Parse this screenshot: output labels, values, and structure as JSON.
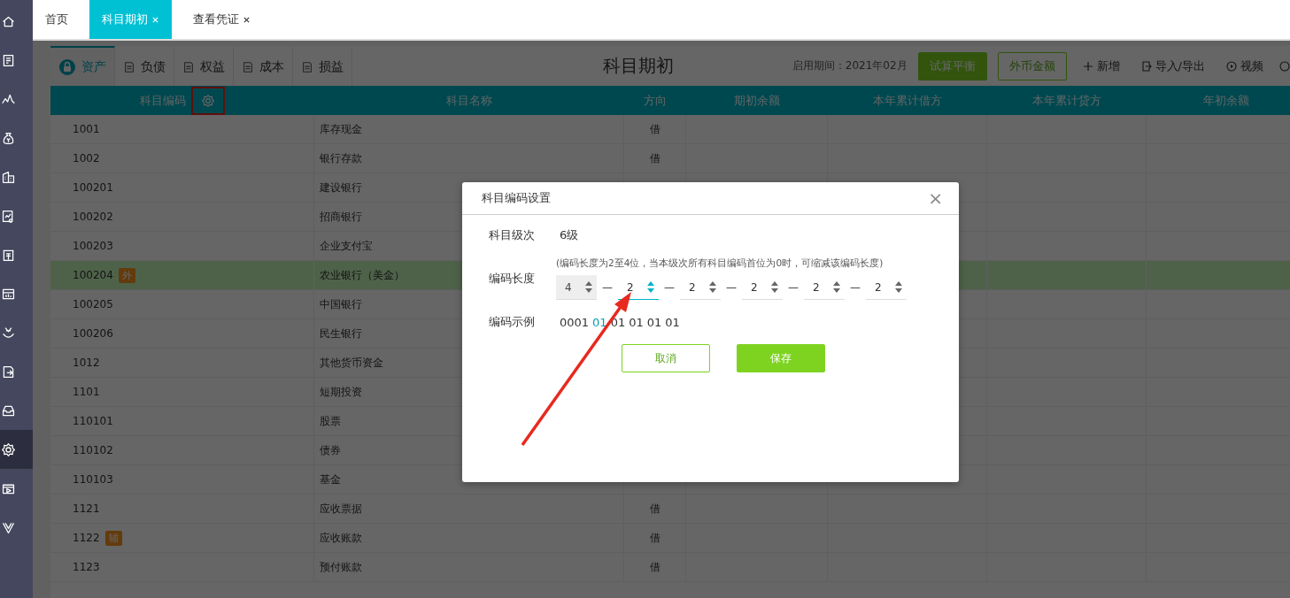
{
  "sidebar": {
    "items": [
      {
        "selected": false
      },
      {
        "selected": false
      },
      {
        "selected": false
      },
      {
        "selected": false
      },
      {
        "selected": false
      },
      {
        "selected": false
      },
      {
        "selected": false
      },
      {
        "selected": false
      },
      {
        "selected": false
      },
      {
        "selected": false
      },
      {
        "selected": false
      },
      {
        "selected": true
      },
      {
        "selected": false
      },
      {
        "selected": false
      }
    ]
  },
  "tabs": [
    {
      "label": "首页",
      "selected": false,
      "closable": false
    },
    {
      "label": "科目期初",
      "selected": true,
      "closable": true
    },
    {
      "label": "查看凭证",
      "selected": false,
      "closable": true
    }
  ],
  "categories": [
    {
      "label": "资产",
      "selected": true
    },
    {
      "label": "负债",
      "selected": false
    },
    {
      "label": "权益",
      "selected": false
    },
    {
      "label": "成本",
      "selected": false
    },
    {
      "label": "损益",
      "selected": false
    }
  ],
  "page_title": "科目期初",
  "period": "启用期间：2021年02月",
  "buttons": [
    {
      "label": "试算平衡",
      "kind": "primary"
    },
    {
      "label": "外币金额",
      "kind": "outline"
    },
    {
      "label": "新增",
      "kind": "add"
    },
    {
      "label": "导入/导出",
      "kind": "import"
    },
    {
      "label": "视频",
      "kind": "video"
    }
  ],
  "table": {
    "columns": [
      "科目编码",
      "科目名称",
      "方向",
      "期初余额",
      "本年累计借方",
      "本年累计贷方",
      "年初余额"
    ],
    "rows": [
      {
        "code": "1001",
        "name": "库存现金",
        "direction": "借",
        "selected": false
      },
      {
        "code": "1002",
        "name": "银行存款",
        "direction": "借",
        "selected": false
      },
      {
        "code": "100201",
        "name": "建设银行",
        "selected": false
      },
      {
        "code": "100202",
        "name": "招商银行",
        "selected": false
      },
      {
        "code": "100203",
        "name": "企业支付宝",
        "selected": false
      },
      {
        "code": "100204",
        "badge": "外",
        "name": "农业银行（美金）",
        "selected": true
      },
      {
        "code": "100205",
        "name": "中国银行",
        "selected": false
      },
      {
        "code": "100206",
        "name": "民生银行",
        "selected": false
      },
      {
        "code": "1012",
        "name": "其他货币资金",
        "selected": false
      },
      {
        "code": "1101",
        "name": "短期投资",
        "selected": false
      },
      {
        "code": "110101",
        "name": "股票",
        "selected": false
      },
      {
        "code": "110102",
        "name": "债券",
        "selected": false
      },
      {
        "code": "110103",
        "name": "基金",
        "selected": false
      },
      {
        "code": "1121",
        "name": "应收票据",
        "direction": "借",
        "selected": false
      },
      {
        "code": "1122",
        "badge": "辅",
        "name": "应收账款",
        "direction": "借",
        "selected": false
      },
      {
        "code": "1123",
        "name": "预付账款",
        "direction": "借",
        "selected": false
      }
    ]
  },
  "dialog": {
    "title": "科目编码设置",
    "close": "×",
    "level_label": "科目级次",
    "level_value": "6级",
    "length_label": "编码长度",
    "length_hint": "(编码长度为2至4位，当本级次所有科目编码首位为0时，可缩减该编码长度)",
    "separator": "—",
    "segments": [
      {
        "value": "4",
        "disabled": true,
        "focused": false
      },
      {
        "value": "2",
        "disabled": false,
        "focused": true
      },
      {
        "value": "2",
        "disabled": false,
        "focused": false
      },
      {
        "value": "2",
        "disabled": false,
        "focused": false
      },
      {
        "value": "2",
        "disabled": false,
        "focused": false
      },
      {
        "value": "2",
        "disabled": false,
        "focused": false
      }
    ],
    "example_label": "编码示例",
    "example": [
      {
        "text": "0001",
        "highlighted": false
      },
      {
        "text": "01",
        "highlighted": true
      },
      {
        "text": "01",
        "highlighted": false
      },
      {
        "text": "01",
        "highlighted": false
      },
      {
        "text": "01",
        "highlighted": false
      },
      {
        "text": "01",
        "highlighted": false
      }
    ],
    "cancel": "取消",
    "save": "保存"
  }
}
